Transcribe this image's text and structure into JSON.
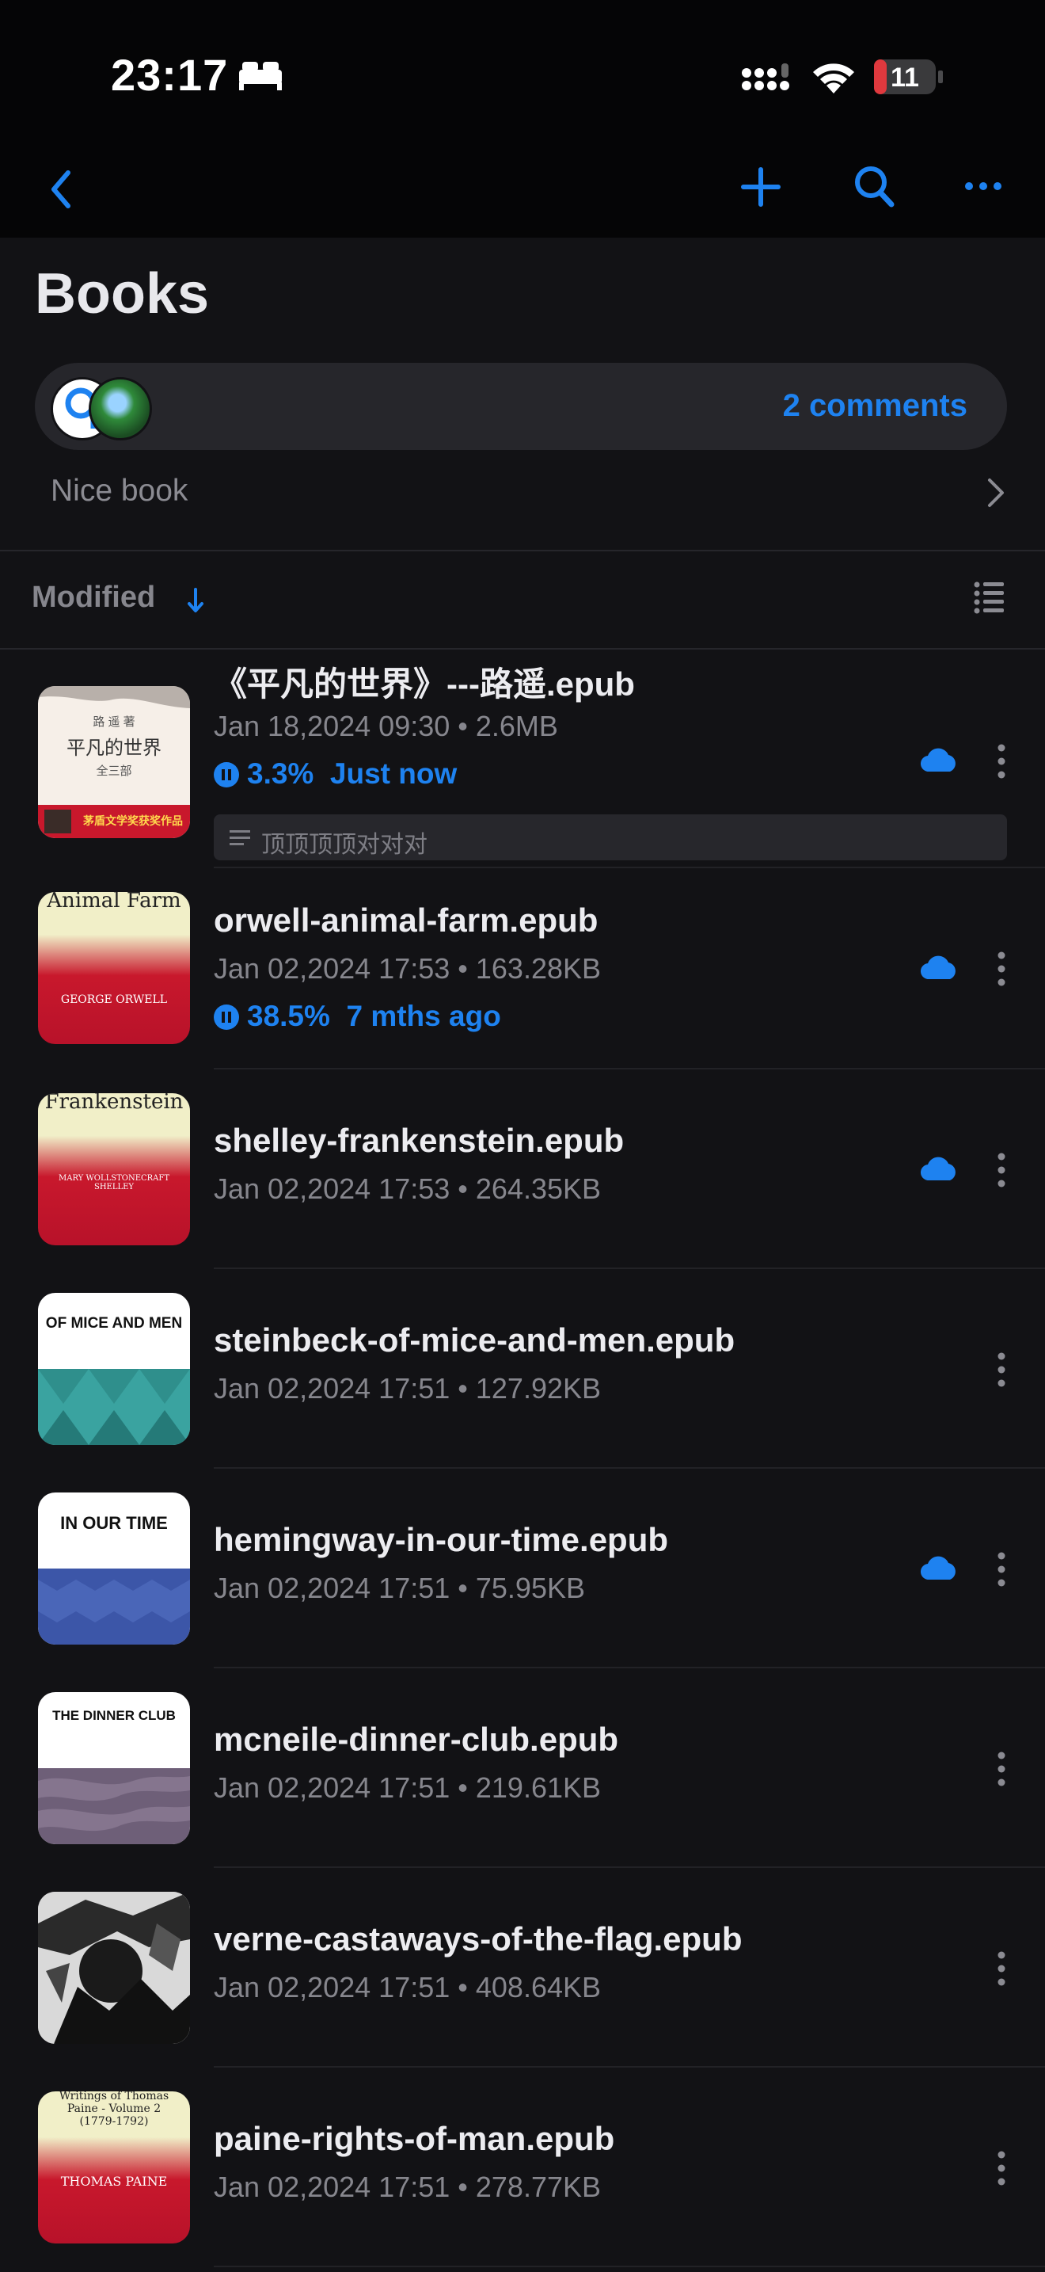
{
  "status_bar": {
    "time": "23:17",
    "battery_level": "11"
  },
  "header": {
    "title": "Books"
  },
  "comments": {
    "count_label": "2 comments",
    "note": "Nice book"
  },
  "sort": {
    "label": "Modified",
    "direction": "descending"
  },
  "books": [
    {
      "title": "《平凡的世界》---路遥.epub",
      "meta": "Jan 18,2024 09:30 • 2.6MB",
      "progress": "3.3%",
      "last_read": "Just now",
      "note": "顶顶顶顶对对对",
      "cloud": true,
      "cover": {
        "author": "路 遥 著",
        "title": "平凡的世界",
        "volume": "全三部",
        "band": "茅盾文学奖获奖作品",
        "band2": ""
      }
    },
    {
      "title": "orwell-animal-farm.epub",
      "meta": "Jan 02,2024 17:53 • 163.28KB",
      "progress": "38.5%",
      "last_read": "7 mths ago",
      "cloud": true,
      "cover": {
        "title": "Animal Farm",
        "author": "GEORGE ORWELL"
      }
    },
    {
      "title": "shelley-frankenstein.epub",
      "meta": "Jan 02,2024 17:53 • 264.35KB",
      "cloud": true,
      "cover": {
        "title": "Frankenstein",
        "author": "MARY WOLLSTONECRAFT SHELLEY"
      }
    },
    {
      "title": "steinbeck-of-mice-and-men.epub",
      "meta": "Jan 02,2024 17:51 • 127.92KB",
      "cloud": false,
      "cover": {
        "title": "OF MICE AND MEN"
      }
    },
    {
      "title": "hemingway-in-our-time.epub",
      "meta": "Jan 02,2024 17:51 • 75.95KB",
      "cloud": true,
      "cover": {
        "title": "IN OUR TIME"
      }
    },
    {
      "title": "mcneile-dinner-club.epub",
      "meta": "Jan 02,2024 17:51 • 219.61KB",
      "cloud": false,
      "cover": {
        "title": "THE DINNER CLUB"
      }
    },
    {
      "title": "verne-castaways-of-the-flag.epub",
      "meta": "Jan 02,2024 17:51 • 408.64KB",
      "cloud": false,
      "cover": {
        "title": ""
      }
    },
    {
      "title": "paine-rights-of-man.epub",
      "meta": "Jan 02,2024 17:51 • 278.77KB",
      "cloud": false,
      "cover": {
        "title": "Writings of Thomas Paine - Volume 2 (1779-1792)",
        "author": "THOMAS PAINE"
      }
    }
  ],
  "colors": {
    "accent": "#1e82f0",
    "background": "#121215",
    "cover_red": "#c8182c",
    "cover_cream": "#f1efc8"
  }
}
